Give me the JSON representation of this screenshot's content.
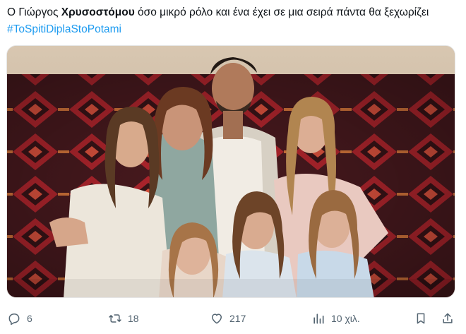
{
  "tweet": {
    "text_before": "Ο Γιώργος ",
    "text_bold": "Χρυσοστόμου",
    "text_after": " όσο μικρό ρόλο και ένα έχει σε μια σειρά πάντα θα ξεχωρίζει ",
    "hashtag": "#ToSpitiDiplaStoPotami"
  },
  "media": {
    "alt": "Family photo: a man with curly hair and a beard standing with a woman and five girls in front of a red patterned kilim rug"
  },
  "actions": {
    "reply_count": "6",
    "retweet_count": "18",
    "like_count": "217",
    "views_count": "10 χιλ."
  },
  "icons": {
    "reply": "reply-icon",
    "retweet": "retweet-icon",
    "like": "heart-icon",
    "views": "analytics-icon",
    "bookmark": "bookmark-icon",
    "share": "share-icon"
  },
  "colors": {
    "accent": "#1d9bf0",
    "text": "#0f1419",
    "muted": "#536471"
  }
}
